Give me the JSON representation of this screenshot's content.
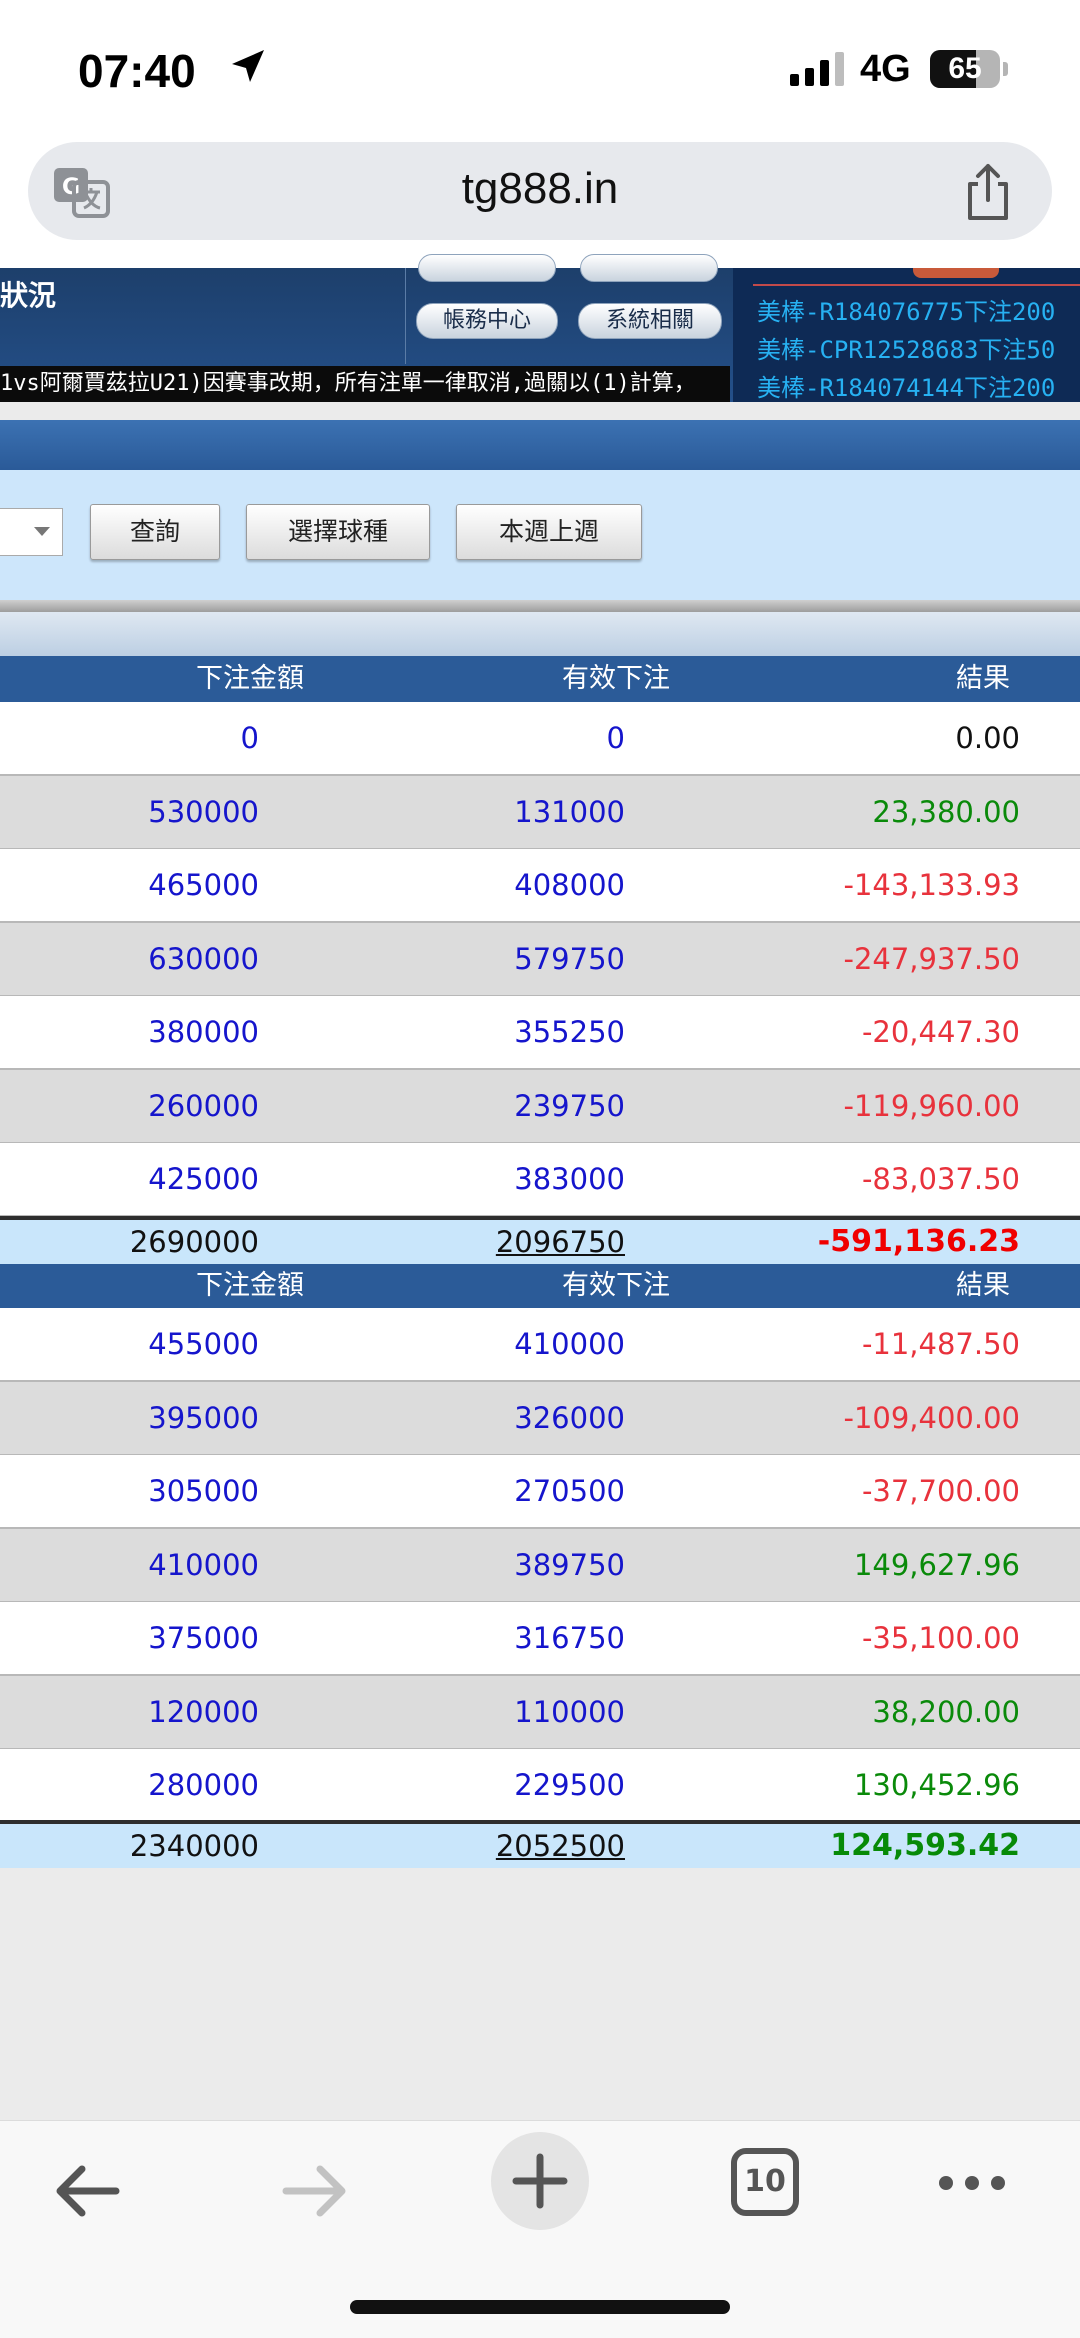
{
  "status_bar": {
    "time": "07:40",
    "network": "4G",
    "battery": "65",
    "battery_level": 0.65
  },
  "browser": {
    "url": "tg888.in",
    "tab_count": "10"
  },
  "site_header": {
    "title": "狀況",
    "menu": [
      "帳務中心",
      "系統相關"
    ],
    "marquee": "1vs阿爾賈茲拉U21)因賽事改期，所有注單一律取消,過關以(1)計算，",
    "feed": [
      "美棒-R184076775下注200",
      "美棒-CPR12528683下注50",
      "美棒-R184074144下注200"
    ]
  },
  "filter": {
    "query_button": "查詢",
    "sport_button": "選擇球種",
    "week_button": "本週上週"
  },
  "tables": [
    {
      "headers": [
        "下注金額",
        "有效下注",
        "結果"
      ],
      "rows": [
        [
          "0",
          "0",
          "0.00"
        ],
        [
          "530000",
          "131000",
          "23,380.00"
        ],
        [
          "465000",
          "408000",
          "-143,133.93"
        ],
        [
          "630000",
          "579750",
          "-247,937.50"
        ],
        [
          "380000",
          "355250",
          "-20,447.30"
        ],
        [
          "260000",
          "239750",
          "-119,960.00"
        ],
        [
          "425000",
          "383000",
          "-83,037.50"
        ]
      ],
      "total": [
        "2690000",
        "2096750",
        "-591,136.23"
      ]
    },
    {
      "headers": [
        "下注金額",
        "有效下注",
        "結果"
      ],
      "rows": [
        [
          "455000",
          "410000",
          "-11,487.50"
        ],
        [
          "395000",
          "326000",
          "-109,400.00"
        ],
        [
          "305000",
          "270500",
          "-37,700.00"
        ],
        [
          "410000",
          "389750",
          "149,627.96"
        ],
        [
          "375000",
          "316750",
          "-35,100.00"
        ],
        [
          "120000",
          "110000",
          "38,200.00"
        ],
        [
          "280000",
          "229500",
          "130,452.96"
        ]
      ],
      "total": [
        "2340000",
        "2052500",
        "124,593.42"
      ]
    }
  ],
  "colors": {
    "positive": "#0a8a0a",
    "negative": "#e8323c",
    "header_blue": "#2b5b98",
    "link_blue": "#1515cc"
  }
}
